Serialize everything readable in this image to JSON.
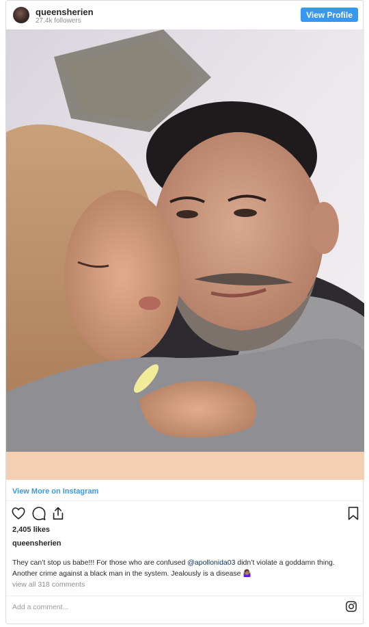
{
  "header": {
    "username": "queensherien",
    "followers": "27.4k followers",
    "view_profile_label": "View Profile"
  },
  "post": {
    "view_more_label": "View More on Instagram",
    "likes": "2,405 likes",
    "owner": "queensherien",
    "caption_before": "They can’t stop us babe!!! For those who are confused ",
    "caption_mention": "@apollonida03",
    "caption_after": " didn’t violate a goddamn thing. Another crime against a black man in the system. Jealously is a disease 🤷🏽‍♀️",
    "view_comments": "view all 318 comments",
    "add_comment_placeholder": "Add a comment..."
  },
  "icons": {
    "like": "heart-icon",
    "comment": "comment-icon",
    "share": "share-icon",
    "save": "bookmark-icon",
    "brand": "instagram-icon"
  },
  "colors": {
    "accent": "#3897f0",
    "mention": "#003569",
    "muted": "#8e8e8e"
  }
}
